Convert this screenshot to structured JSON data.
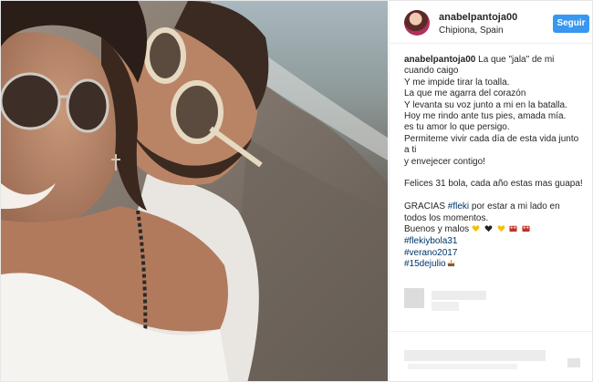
{
  "post": {
    "username": "anabelpantoja00",
    "location": "Chipiona, Spain",
    "follow_label": "Seguir",
    "caption": {
      "first_line_text": "La que \"jala\" de mi",
      "lines": [
        "cuando caigo",
        "Y me impide tirar la toalla.",
        "La que me agarra del corazón",
        "Y levanta su voz junto a mi en la batalla.",
        "Hoy me rindo ante tus pies, amada mía.",
        "es tu amor lo que persigo.",
        "Permiteme vivir cada día de esta vida junto",
        "a ti",
        "y envejecer contigo!"
      ],
      "line_after_gap": "Felices 31 bola, cada año estas mas guapa!",
      "thanks_prefix": "GRACIAS ",
      "thanks_tag": "#fleki",
      "thanks_suffix": " por estar a mi lado en",
      "thanks_line2": "todos los momentos.",
      "buenos_line": "Buenos y malos ",
      "hashtags": [
        "#flekiybola31",
        "#verano2017",
        "#15dejulio"
      ]
    },
    "emoji_icons": [
      "yellow-heart-icon",
      "black-heart-icon",
      "yellow-heart-icon",
      "couple-icon",
      "couple-icon"
    ],
    "colors": {
      "follow_button": "#3897f0",
      "hashtag": "#003569",
      "text": "#262626"
    }
  }
}
